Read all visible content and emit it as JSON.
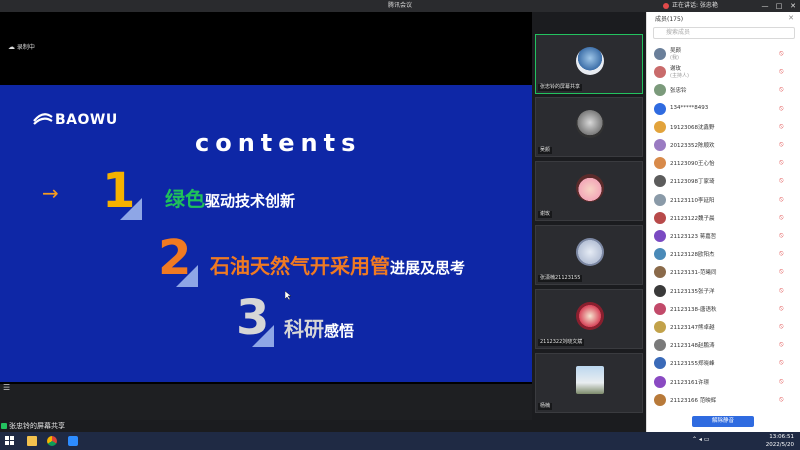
{
  "window": {
    "title": "腾讯会议",
    "share_status": "正在讲话: 张忠艳",
    "buttons": [
      "—",
      "□",
      "✕"
    ]
  },
  "meeting": {
    "recording_label": "录制中",
    "share_bar_text": "张忠铃的屏幕共享"
  },
  "slide": {
    "logo_text": "BAOWU",
    "heading": "contents",
    "items": [
      {
        "number": "1",
        "highlight": "绿色",
        "rest": "驱动技术创新"
      },
      {
        "number": "2",
        "highlight": "石油天然气开采用管",
        "rest": "进展及思考"
      },
      {
        "number": "3",
        "highlight": "科研",
        "rest": "感悟"
      }
    ],
    "arrow": "→",
    "colors": {
      "background": "#0e27a6",
      "item1": "#1fc15a",
      "item2": "#f07a22",
      "item3": "#d6d6d6"
    }
  },
  "thumbnails": [
    {
      "name": "张忠铃的屏幕共享",
      "active": true
    },
    {
      "name": "吴颜",
      "active": false
    },
    {
      "name": "谢玫",
      "active": false
    },
    {
      "name": "张潇楠21123155",
      "active": false
    },
    {
      "name": "2112322刘晓文斌",
      "active": false
    },
    {
      "name": "杨楠",
      "active": false
    }
  ],
  "panel": {
    "title": "成员(175)",
    "search_placeholder": "搜索成员",
    "members": [
      {
        "name": "吴颜",
        "role": "(我)"
      },
      {
        "name": "谢玫",
        "role": "(主持人)"
      },
      {
        "name": "张忠铃",
        "role": ""
      },
      {
        "name": "134*****8493",
        "role": ""
      },
      {
        "name": "19123068沈鑫野",
        "role": ""
      },
      {
        "name": "20123352陈顺欢",
        "role": ""
      },
      {
        "name": "21123090王心怡",
        "role": ""
      },
      {
        "name": "21123098丁家琦",
        "role": ""
      },
      {
        "name": "21123110李延阳",
        "role": ""
      },
      {
        "name": "21123122魏子晨",
        "role": ""
      },
      {
        "name": "21123123 蒋嘉哲",
        "role": ""
      },
      {
        "name": "21123128欧阳杰",
        "role": ""
      },
      {
        "name": "21123131-范曦同",
        "role": ""
      },
      {
        "name": "21123135张子洋",
        "role": ""
      },
      {
        "name": "21123138-唐语秋",
        "role": ""
      },
      {
        "name": "21123147熊卓越",
        "role": ""
      },
      {
        "name": "21123148赵鹏涛",
        "role": ""
      },
      {
        "name": "21123155郑晓峰",
        "role": ""
      },
      {
        "name": "21123161许璟",
        "role": ""
      },
      {
        "name": "21123166 范映辉",
        "role": ""
      }
    ],
    "unmute_label": "解除静音"
  },
  "taskbar": {
    "time": "13:06:51",
    "date": "2022/5/20"
  }
}
